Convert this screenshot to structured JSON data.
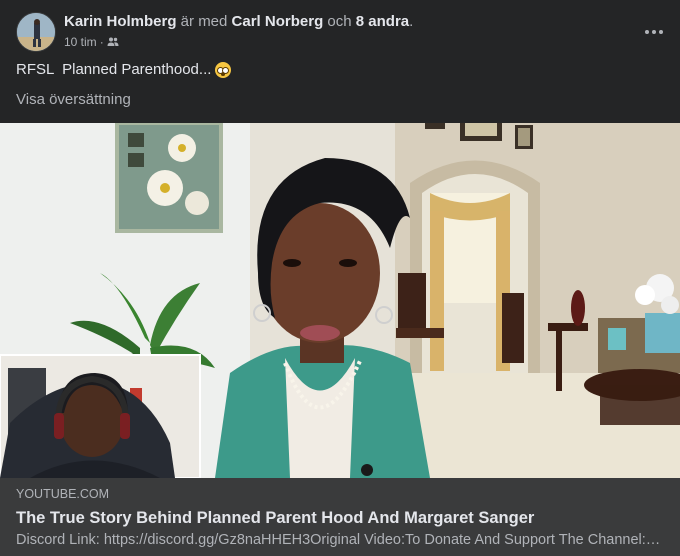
{
  "post": {
    "author": "Karin Holmberg",
    "with_text": " är med ",
    "tagged": "Carl Norberg",
    "and_text": " och ",
    "others": "8 andra",
    "period": ".",
    "time": "10 tim",
    "dot": " · ",
    "audience_icon": "friends-icon",
    "more_icon": "more-horizontal-icon",
    "text": "RFSL  Planned Parenthood...",
    "emoji_icon": "flushed-face-emoji",
    "see_translation": "Visa översättning"
  },
  "link": {
    "domain": "YOUTUBE.COM",
    "title": "The True Story Behind Planned Parent Hood And Margaret Sanger",
    "description": "Discord Link: https://discord.gg/Gz8naHHEH3Original Video:To Donate And Support The Channel: Cashapp $"
  },
  "colors": {
    "card_bg": "#242526",
    "link_bg": "#3a3b3c",
    "text_primary": "#e4e6eb",
    "text_secondary": "#b0b3b8"
  }
}
